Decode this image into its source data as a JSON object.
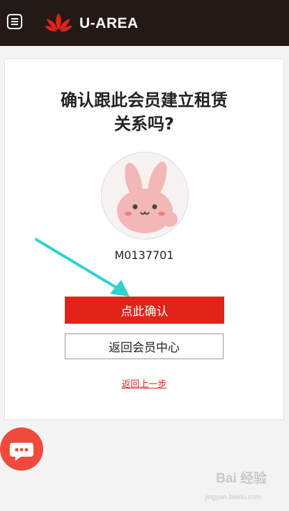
{
  "header": {
    "brand_name": "U-AREA",
    "menu_icon": "hamburger-menu-icon",
    "logo_icon": "red-lotus-logo-icon"
  },
  "card": {
    "title": "确认跟此会员建立租赁\n关系吗?",
    "avatar_icon": "pink-bunny-avatar",
    "member_id": "M0137701",
    "confirm_label": "点此确认",
    "back_center_label": "返回会员中心",
    "back_step_label": "返回上一步"
  },
  "chat": {
    "icon": "chat-bubble-icon"
  },
  "watermark": {
    "logo_text": "Bai 经验",
    "site": "jingyan.baidu.com"
  },
  "colors": {
    "header_bg": "#231a17",
    "accent_red": "#e2231a",
    "chat_red": "#f04a3c",
    "arrow_cyan": "#2ed3cf"
  }
}
